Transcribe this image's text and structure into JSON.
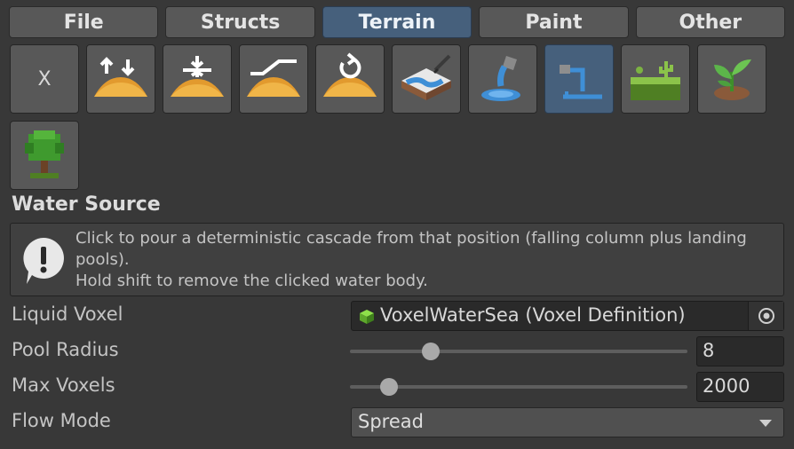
{
  "tabs": [
    {
      "label": "File",
      "active": false
    },
    {
      "label": "Structs",
      "active": false
    },
    {
      "label": "Terrain",
      "active": true
    },
    {
      "label": "Paint",
      "active": false
    },
    {
      "label": "Other",
      "active": false
    }
  ],
  "tools": [
    {
      "name": "deselect-tool",
      "label": "X",
      "icon": "x-label"
    },
    {
      "name": "raise-lower-tool",
      "icon": "raise-lower-icon"
    },
    {
      "name": "flatten-tool",
      "icon": "flatten-icon"
    },
    {
      "name": "slope-tool",
      "icon": "slope-icon"
    },
    {
      "name": "smooth-rotate-tool",
      "icon": "rotate-terrain-icon"
    },
    {
      "name": "river-paint-tool",
      "icon": "river-brush-icon"
    },
    {
      "name": "water-fill-tool",
      "icon": "water-pour-icon"
    },
    {
      "name": "water-source-tool",
      "icon": "water-source-icon",
      "selected": true
    },
    {
      "name": "grass-tool",
      "icon": "grass-cactus-icon"
    },
    {
      "name": "plant-tool",
      "icon": "sprout-icon"
    },
    {
      "name": "tree-tool",
      "icon": "tree-icon"
    }
  ],
  "section": {
    "title": "Water Source"
  },
  "help": {
    "icon": "warning-bubble-icon",
    "line1": "Click to pour a deterministic cascade from that position (falling column plus landing pools).",
    "line2": "Hold shift to remove the clicked water body."
  },
  "fields": {
    "liquid": {
      "label": "Liquid Voxel",
      "value": "VoxelWaterSea (Voxel Definition)",
      "icon": "voxel-cube-icon",
      "picker_icon": "object-picker-icon"
    },
    "pool_radius": {
      "label": "Pool Radius",
      "value": "8",
      "slider_fraction": 0.24
    },
    "max_voxels": {
      "label": "Max Voxels",
      "value": "2000",
      "slider_fraction": 0.115
    },
    "flow_mode": {
      "label": "Flow Mode",
      "value": "Spread"
    }
  },
  "colors": {
    "accent": "#46607c",
    "background": "#383838",
    "button": "#585858"
  }
}
